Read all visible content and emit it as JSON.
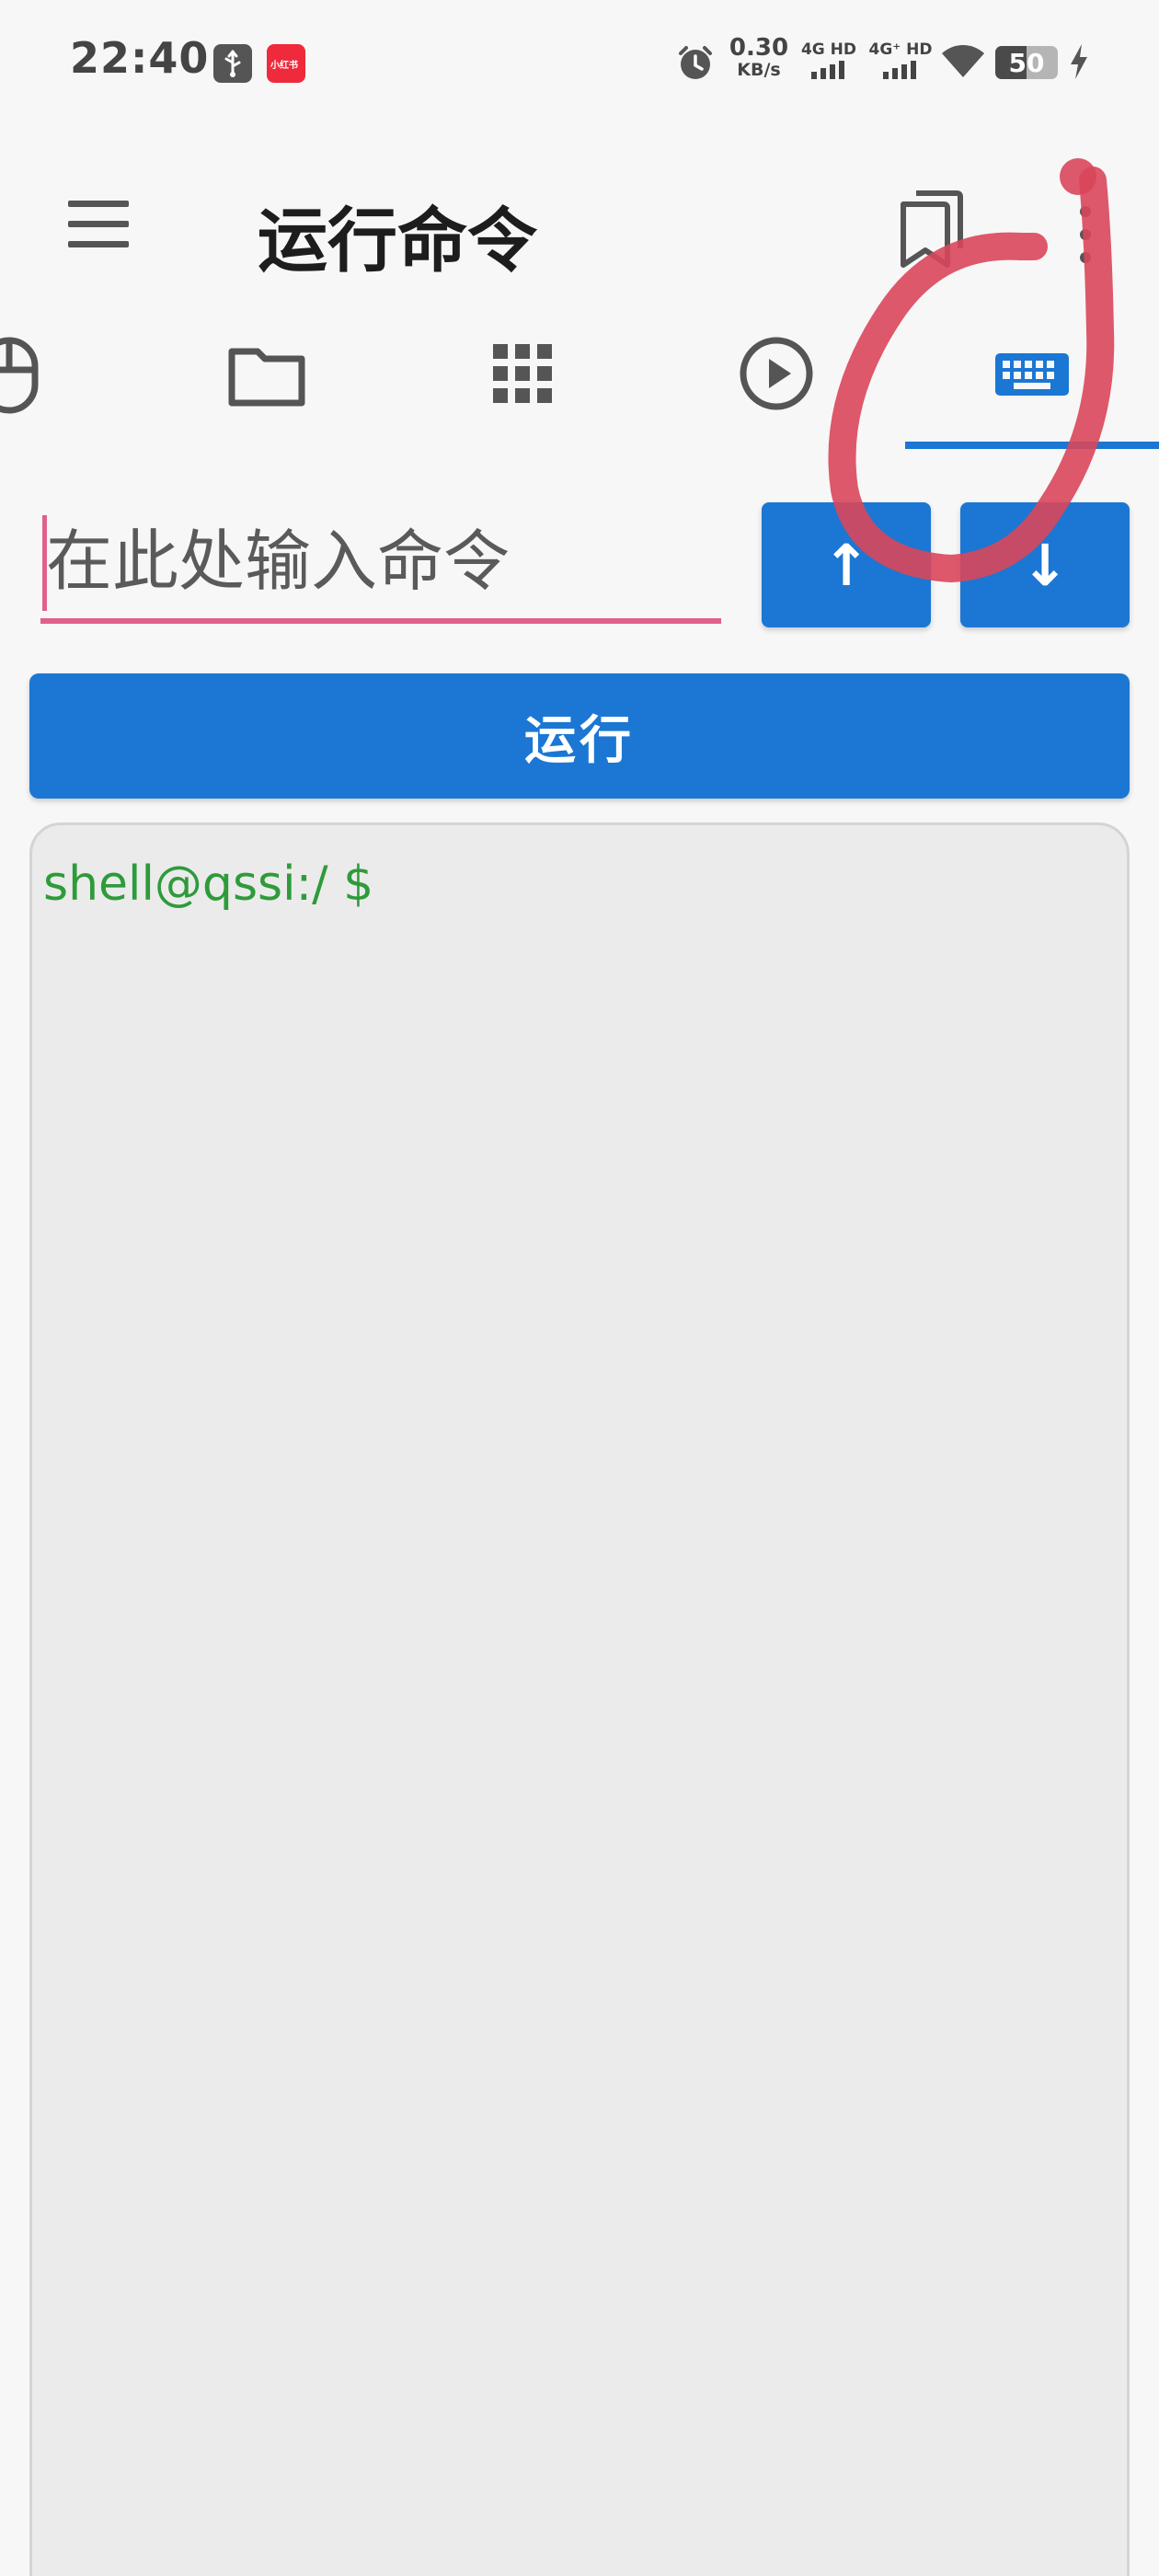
{
  "status_bar": {
    "time": "22:40",
    "app_badge": "小红书",
    "network_speed": "0.30",
    "network_speed_unit": "KB/s",
    "sim1_label": "4G HD",
    "sim2_label": "4G⁺ HD",
    "battery_level": "50",
    "battery_fraction": 0.5
  },
  "app_bar": {
    "title": "运行命令",
    "menu_icon": "hamburger-menu-icon",
    "bookmark_icon": "bookmarks-icon",
    "more_icon": "more-vertical-icon"
  },
  "tabs": [
    {
      "icon": "mouse-icon",
      "selected": false
    },
    {
      "icon": "folder-icon",
      "selected": false
    },
    {
      "icon": "apps-grid-icon",
      "selected": false
    },
    {
      "icon": "play-circle-icon",
      "selected": false
    },
    {
      "icon": "keyboard-icon",
      "selected": true
    }
  ],
  "command": {
    "placeholder": "在此处输入命令",
    "value": "",
    "history_up_label": "↑",
    "history_down_label": "↓",
    "run_label": "运行"
  },
  "terminal": {
    "prompt": "shell@qssi:/ $"
  },
  "colors": {
    "accent": "#1b77d3",
    "input_underline": "#e0608a",
    "prompt": "#2e9b3a",
    "annotation": "#d9465a"
  }
}
